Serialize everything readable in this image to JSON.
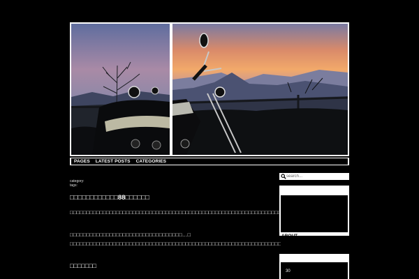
{
  "nav": {
    "items": [
      {
        "label": "PAGES"
      },
      {
        "label": "LATEST POSTS"
      },
      {
        "label": "CATEGORIES"
      }
    ]
  },
  "post": {
    "category_label": "category:",
    "tags_label": "tags:",
    "title": "□□□□□□□□□□□□88□□□□□□",
    "paragraphs": [
      "□□□□□□□□□□□□□□□□□□□□□□□□□□□□□□□□□□□□□□□□□□□□□□□□□□□□□□□□□□□□□□□□□□□□",
      "□□□□□□□□□□□□□□□□□□□□□□□□□□□□□□□□□□…□ □□□□□□□□□□□□□□□□□□□□□□□□□□□□□□□□□□□□□□□□□□□□□□□□□□□□□□□□□□□□□□□□□□□□□"
    ],
    "subheading": "□□□□□□□"
  },
  "sidebar": {
    "search_placeholder": "search...",
    "about_label": "ABOUT",
    "calendar_day": "30"
  },
  "colors": {
    "background": "#000000",
    "frame": "#ffffff"
  }
}
